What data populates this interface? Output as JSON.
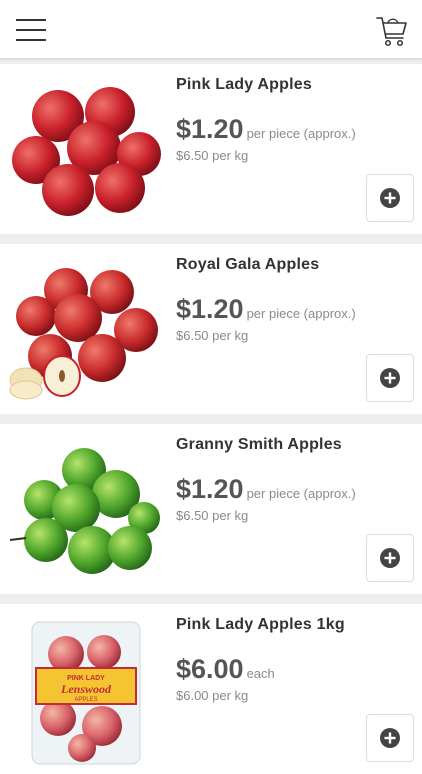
{
  "header": {
    "menu_icon": "hamburger-menu-icon",
    "cart_icon": "shopping-cart-icon"
  },
  "products": [
    {
      "title": "Pink Lady Apples",
      "price": "$1.20",
      "unit": "per piece (approx.)",
      "per_kg": "$6.50 per kg"
    },
    {
      "title": "Royal Gala Apples",
      "price": "$1.20",
      "unit": "per piece (approx.)",
      "per_kg": "$6.50 per kg"
    },
    {
      "title": "Granny Smith Apples",
      "price": "$1.20",
      "unit": "per piece (approx.)",
      "per_kg": "$6.50 per kg"
    },
    {
      "title": "Pink Lady Apples 1kg",
      "price": "$6.00",
      "unit": "each",
      "per_kg": "$6.00 per kg",
      "package_label_brand": "PINK LADY",
      "package_label_name": "Lenswood",
      "package_label_sub": "APPLES"
    }
  ],
  "colors": {
    "red_apple": "#c8202a",
    "green_apple": "#4fa62b",
    "text_dark": "#333333",
    "text_muted": "#8a8a8a"
  }
}
